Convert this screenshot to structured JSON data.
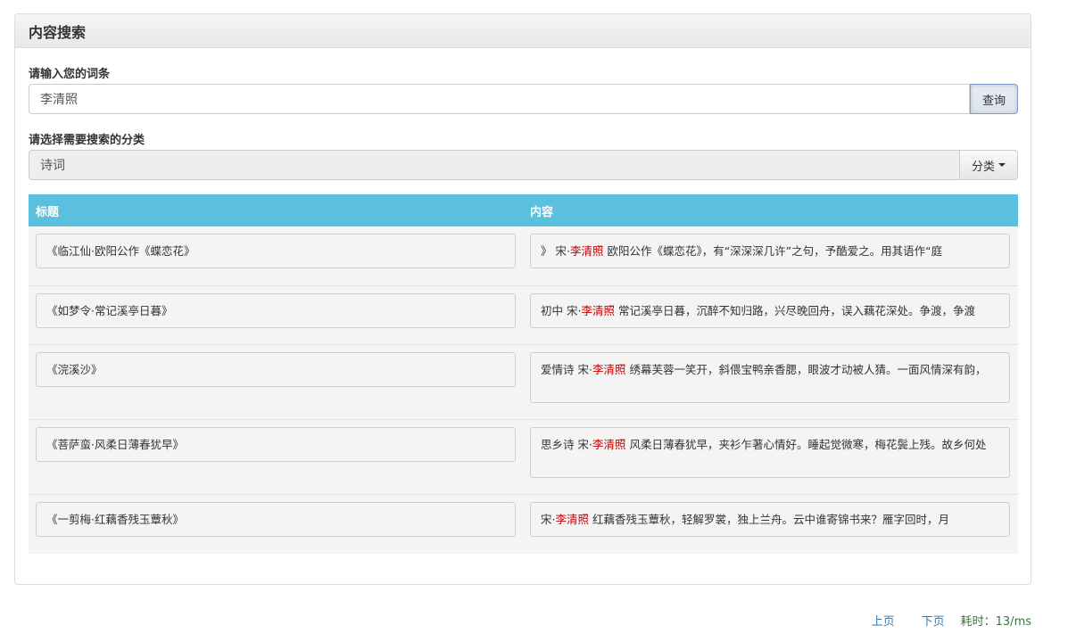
{
  "panel": {
    "title": "内容搜索"
  },
  "search": {
    "label": "请输入您的词条",
    "value": "李清照",
    "button": "查询"
  },
  "category": {
    "label": "请选择需要搜索的分类",
    "value": "诗词",
    "button": "分类"
  },
  "table": {
    "headers": {
      "title": "标题",
      "content": "内容"
    },
    "rows": [
      {
        "title": "《临江仙·欧阳公作《蝶恋花》",
        "prefix": "》 宋·",
        "author": "李清照",
        "text": " 欧阳公作《蝶恋花》，有“深深深几许”之句，予酷爱之。用其语作“庭"
      },
      {
        "title": "《如梦令·常记溪亭日暮》",
        "prefix": "初中 宋·",
        "author": "李清照",
        "text": " 常记溪亭日暮，沉醉不知归路，兴尽晚回舟，误入藕花深处。争渡，争渡"
      },
      {
        "title": "《浣溪沙》",
        "prefix": "爱情诗 宋·",
        "author": "李清照",
        "text": " 绣幕芙蓉一笑开，斜偎宝鸭亲香腮，眼波才动被人猜。一面风情深有韵，"
      },
      {
        "title": "《菩萨蛮·风柔日薄春犹早》",
        "prefix": "思乡诗 宋·",
        "author": "李清照",
        "text": " 风柔日薄春犹早，夹衫乍著心情好。睡起觉微寒，梅花鬓上残。故乡何处"
      },
      {
        "title": "《一剪梅·红藕香残玉蕈秋》",
        "prefix": " 宋·",
        "author": "李清照",
        "text": " 红藕香残玉蕈秋，轻解罗裳，独上兰舟。云中谁寄锦书来？雁字回时，月"
      }
    ]
  },
  "footer": {
    "prev": "上页",
    "next": "下页",
    "elapsed": "耗时：13/ms"
  },
  "colors": {
    "accent": "#5bc0de",
    "highlight": "#cc0000",
    "link": "#337ab7",
    "elapsed": "#3c763d"
  }
}
